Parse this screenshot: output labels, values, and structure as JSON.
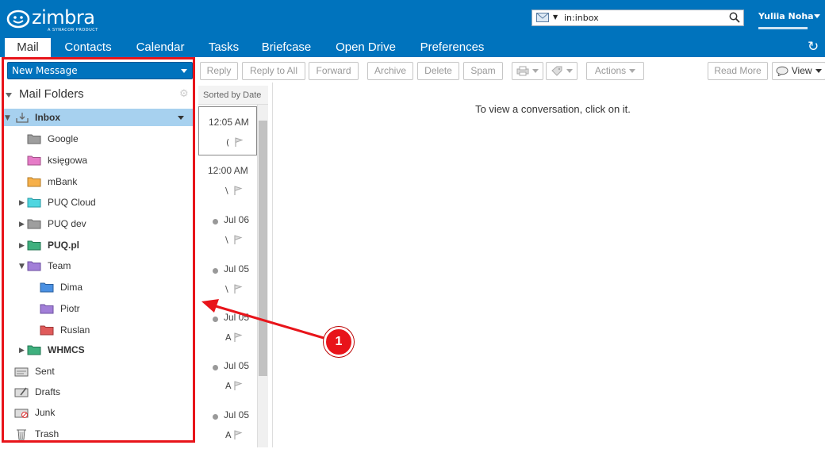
{
  "brand": {
    "name": "zimbra",
    "tagline": "A SYNACOR PRODUCT",
    "color": "#0073bd"
  },
  "search": {
    "value": "in:inbox"
  },
  "user": {
    "name": "Yuliia Noha"
  },
  "tabs": [
    {
      "label": "Mail",
      "active": true
    },
    {
      "label": "Contacts"
    },
    {
      "label": "Calendar"
    },
    {
      "label": "Tasks"
    },
    {
      "label": "Briefcase"
    },
    {
      "label": "Open Drive"
    },
    {
      "label": "Preferences"
    }
  ],
  "sidebar": {
    "new_message": "New Message",
    "folders_title": "Mail Folders",
    "inbox": "Inbox",
    "folders": [
      {
        "label": "Google",
        "color": "#9e9e9e"
      },
      {
        "label": "księgowa",
        "color": "#e67bc7"
      },
      {
        "label": "mBank",
        "color": "#f6b04a"
      },
      {
        "label": "PUQ Cloud",
        "color": "#4fd6e0"
      },
      {
        "label": "PUQ dev",
        "color": "#9e9e9e"
      },
      {
        "label": "PUQ.pl",
        "color": "#3fb07e"
      },
      {
        "label": "Team",
        "color": "#a27fd8"
      },
      {
        "label": "Dima",
        "color": "#4a90e2"
      },
      {
        "label": "Piotr",
        "color": "#a27fd8"
      },
      {
        "label": "Ruslan",
        "color": "#e05a5a"
      },
      {
        "label": "WHMCS",
        "color": "#3fb07e"
      }
    ],
    "system": [
      {
        "label": "Sent"
      },
      {
        "label": "Drafts"
      },
      {
        "label": "Junk"
      },
      {
        "label": "Trash"
      }
    ]
  },
  "toolbar": {
    "reply": "Reply",
    "reply_all": "Reply to All",
    "forward": "Forward",
    "archive": "Archive",
    "delete": "Delete",
    "spam": "Spam",
    "actions": "Actions",
    "read_more": "Read More",
    "view": "View"
  },
  "list": {
    "sort": "Sorted by Date",
    "messages": [
      {
        "time": "12:05 AM",
        "frag": "("
      },
      {
        "time": "12:00 AM",
        "frag": "\\"
      },
      {
        "time": "Jul 06",
        "frag": "\\"
      },
      {
        "time": "Jul 05",
        "frag": "\\"
      },
      {
        "time": "Jul 05",
        "frag": "A"
      },
      {
        "time": "Jul 05",
        "frag": "A"
      },
      {
        "time": "Jul 05",
        "frag": "A"
      }
    ]
  },
  "reading": {
    "empty": "To view a conversation, click on it."
  },
  "annotation": {
    "number": "1",
    "color": "#e8141a"
  }
}
